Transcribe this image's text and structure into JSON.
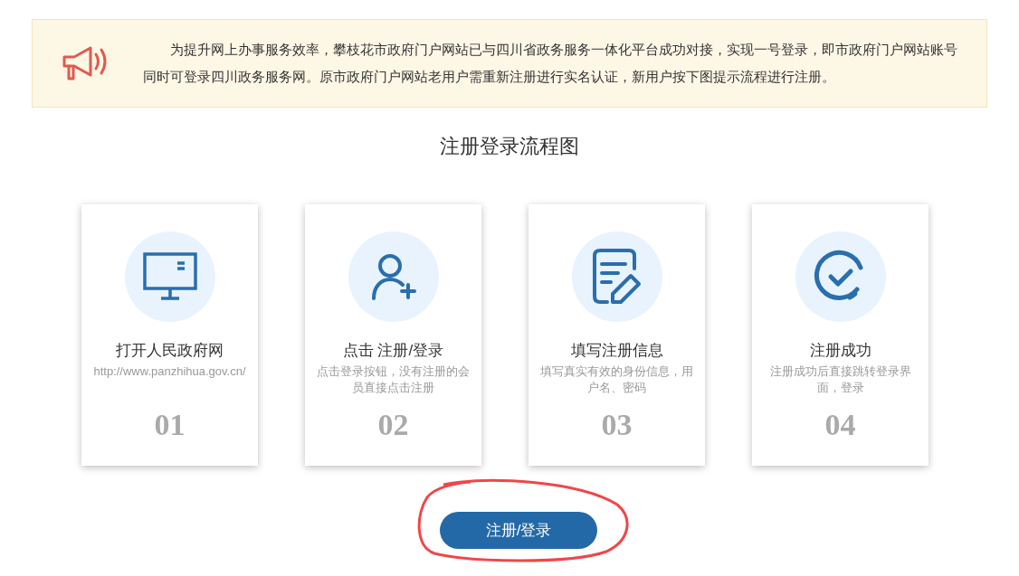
{
  "notice": {
    "text": "为提升网上办事服务效率，攀枝花市政府门户网站已与四川省政务服务一体化平台成功对接，实现一号登录，即市政府门户网站账号同时可登录四川政务服务网。原市政府门户网站老用户需重新注册进行实名认证，新用户按下图提示流程进行注册。"
  },
  "flow": {
    "title": "注册登录流程图",
    "steps": [
      {
        "title": "打开人民政府网",
        "desc": "http://www.panzhihua.gov.cn/",
        "number": "01"
      },
      {
        "title": "点击 注册/登录",
        "desc": "点击登录按钮，没有注册的会员直接点击注册",
        "number": "02"
      },
      {
        "title": "填写注册信息",
        "desc": "填写真实有效的身份信息，用户名、密码",
        "number": "03"
      },
      {
        "title": "注册成功",
        "desc": "注册成功后直接跳转登录界面，登录",
        "number": "04"
      }
    ]
  },
  "button": {
    "label": "注册/登录"
  }
}
